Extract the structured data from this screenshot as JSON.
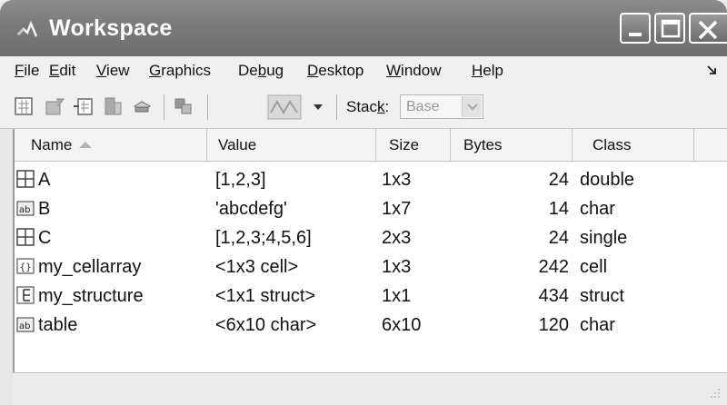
{
  "window": {
    "title": "Workspace"
  },
  "menu": {
    "items": [
      {
        "label": "File",
        "ul": "F",
        "rest": "ile"
      },
      {
        "label": "Edit",
        "ul": "E",
        "rest": "dit"
      },
      {
        "label": "View",
        "ul": "V",
        "rest": "iew"
      },
      {
        "label": "Graphics",
        "ul": "G",
        "rest": "raphics"
      },
      {
        "label": "Debug",
        "pre": "De",
        "ul": "b",
        "rest": "ug"
      },
      {
        "label": "Desktop",
        "ul": "D",
        "rest": "esktop"
      },
      {
        "label": "Window",
        "ul": "W",
        "rest": "indow"
      },
      {
        "label": "Help",
        "ul": "H",
        "rest": "elp"
      }
    ]
  },
  "toolbar": {
    "stack_label_pre": "Stac",
    "stack_label_ul": "k",
    "stack_label_post": ":",
    "stack_value": "Base"
  },
  "table": {
    "columns": [
      "Name",
      "Value",
      "Size",
      "Bytes",
      "Class"
    ],
    "rows": [
      {
        "icon": "matrix-icon",
        "name": "A",
        "value": "[1,2,3]",
        "size": "1x3",
        "bytes": "24",
        "class": "double"
      },
      {
        "icon": "char-icon",
        "name": "B",
        "value": "'abcdefg'",
        "size": "1x7",
        "bytes": "14",
        "class": "char"
      },
      {
        "icon": "matrix-icon",
        "name": "C",
        "value": "[1,2,3;4,5,6]",
        "size": "2x3",
        "bytes": "24",
        "class": "single"
      },
      {
        "icon": "cell-icon",
        "name": "my_cellarray",
        "value": "<1x3 cell>",
        "size": "1x3",
        "bytes": "242",
        "class": "cell"
      },
      {
        "icon": "struct-icon",
        "name": "my_structure",
        "value": "<1x1 struct>",
        "size": "1x1",
        "bytes": "434",
        "class": "struct"
      },
      {
        "icon": "char-icon",
        "name": "table",
        "value": "<6x10 char>",
        "size": "6x10",
        "bytes": "120",
        "class": "char"
      }
    ]
  }
}
